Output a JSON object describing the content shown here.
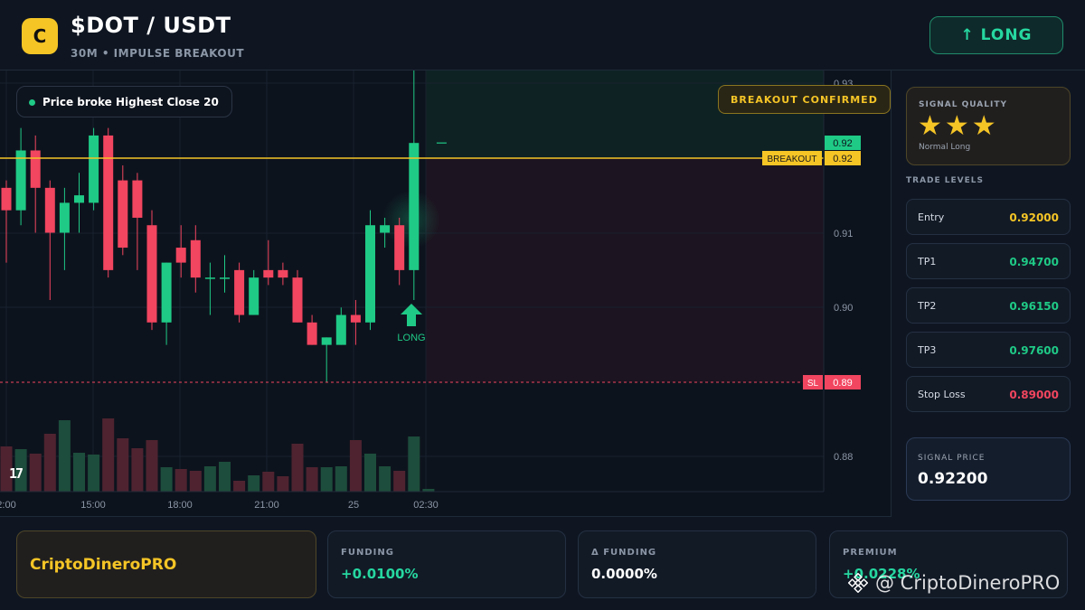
{
  "header": {
    "logo_letter": "C",
    "pair": "$DOT / USDT",
    "subtitle": "30M • IMPULSE BREAKOUT",
    "long_button": "↑ LONG"
  },
  "chart": {
    "note_chip": "Price broke Highest Close 20",
    "confirm_chip": "BREAKOUT CONFIRMED",
    "breakout_tag": "BREAKOUT",
    "breakout_value": "0.92",
    "current_value": "0.92",
    "sl_tag": "SL",
    "sl_value": "0.89",
    "signal_marker": "LONG",
    "tv_logo": "17",
    "colors": {
      "up": "#1fca86",
      "down": "#f2455f",
      "breakout": "#f5c526"
    }
  },
  "chart_data": {
    "type": "candlestick",
    "y_ticks": [
      "0.93",
      "0.91",
      "0.90",
      "0.88"
    ],
    "x_ticks": [
      "2:00",
      "15:00",
      "18:00",
      "21:00",
      "25",
      "02:30"
    ],
    "ylim": [
      0.8755,
      0.9325
    ],
    "breakout_level": 0.92,
    "stop_loss_level": 0.89,
    "candles": [
      {
        "o": 0.916,
        "c": 0.913,
        "h": 0.917,
        "l": 0.906
      },
      {
        "o": 0.913,
        "c": 0.921,
        "h": 0.924,
        "l": 0.911
      },
      {
        "o": 0.921,
        "c": 0.916,
        "h": 0.923,
        "l": 0.91
      },
      {
        "o": 0.916,
        "c": 0.91,
        "h": 0.917,
        "l": 0.901
      },
      {
        "o": 0.91,
        "c": 0.914,
        "h": 0.916,
        "l": 0.905
      },
      {
        "o": 0.914,
        "c": 0.915,
        "h": 0.918,
        "l": 0.91
      },
      {
        "o": 0.914,
        "c": 0.923,
        "h": 0.924,
        "l": 0.913
      },
      {
        "o": 0.923,
        "c": 0.905,
        "h": 0.924,
        "l": 0.904
      },
      {
        "o": 0.917,
        "c": 0.908,
        "h": 0.919,
        "l": 0.907
      },
      {
        "o": 0.917,
        "c": 0.912,
        "h": 0.918,
        "l": 0.905
      },
      {
        "o": 0.911,
        "c": 0.898,
        "h": 0.913,
        "l": 0.897
      },
      {
        "o": 0.898,
        "c": 0.906,
        "h": 0.906,
        "l": 0.895
      },
      {
        "o": 0.908,
        "c": 0.906,
        "h": 0.911,
        "l": 0.904
      },
      {
        "o": 0.909,
        "c": 0.904,
        "h": 0.911,
        "l": 0.902
      },
      {
        "o": 0.904,
        "c": 0.904,
        "h": 0.906,
        "l": 0.899
      },
      {
        "o": 0.904,
        "c": 0.904,
        "h": 0.907,
        "l": 0.902
      },
      {
        "o": 0.905,
        "c": 0.899,
        "h": 0.906,
        "l": 0.898
      },
      {
        "o": 0.899,
        "c": 0.904,
        "h": 0.905,
        "l": 0.899
      },
      {
        "o": 0.905,
        "c": 0.904,
        "h": 0.909,
        "l": 0.903
      },
      {
        "o": 0.905,
        "c": 0.904,
        "h": 0.906,
        "l": 0.903
      },
      {
        "o": 0.904,
        "c": 0.898,
        "h": 0.905,
        "l": 0.898
      },
      {
        "o": 0.898,
        "c": 0.895,
        "h": 0.899,
        "l": 0.895
      },
      {
        "o": 0.895,
        "c": 0.896,
        "h": 0.896,
        "l": 0.89
      },
      {
        "o": 0.895,
        "c": 0.899,
        "h": 0.9,
        "l": 0.895
      },
      {
        "o": 0.899,
        "c": 0.898,
        "h": 0.901,
        "l": 0.895
      },
      {
        "o": 0.898,
        "c": 0.911,
        "h": 0.913,
        "l": 0.897
      },
      {
        "o": 0.91,
        "c": 0.911,
        "h": 0.912,
        "l": 0.908
      },
      {
        "o": 0.911,
        "c": 0.905,
        "h": 0.912,
        "l": 0.903
      },
      {
        "o": 0.905,
        "c": 0.922,
        "h": 0.933,
        "l": 0.901
      },
      {
        "o": 0.922,
        "c": 0.922,
        "h": 0.922,
        "l": 0.922
      }
    ],
    "volume": [
      0.5,
      0.47,
      0.42,
      0.64,
      0.79,
      0.43,
      0.41,
      0.81,
      0.59,
      0.48,
      0.57,
      0.27,
      0.25,
      0.23,
      0.28,
      0.33,
      0.12,
      0.18,
      0.22,
      0.17,
      0.53,
      0.27,
      0.27,
      0.28,
      0.57,
      0.42,
      0.28,
      0.23,
      0.61,
      0.03
    ]
  },
  "panel": {
    "quality_label": "SIGNAL QUALITY",
    "stars": "★★★",
    "quality_mode": "Normal Long",
    "levels_title": "TRADE LEVELS",
    "levels": [
      {
        "name": "Entry",
        "value": "0.92000",
        "color": "#f5c526"
      },
      {
        "name": "TP1",
        "value": "0.94700",
        "color": "#1fca86"
      },
      {
        "name": "TP2",
        "value": "0.96150",
        "color": "#1fca86"
      },
      {
        "name": "TP3",
        "value": "0.97600",
        "color": "#1fca86"
      },
      {
        "name": "Stop Loss",
        "value": "0.89000",
        "color": "#f2455f"
      }
    ],
    "signal_price_label": "SIGNAL PRICE",
    "signal_price_value": "0.92200"
  },
  "footer": {
    "brand": "CriptoDineroPRO",
    "stats": [
      {
        "label": "FUNDING",
        "value": "+0.0100%",
        "color": "#26d7a0"
      },
      {
        "label": "Δ FUNDING",
        "value": "0.0000%",
        "color": "#ffffff"
      },
      {
        "label": "PREMIUM",
        "value": "+0.0228%",
        "color": "#26d7a0"
      }
    ],
    "watermark": "@ CriptoDineroPRO"
  }
}
